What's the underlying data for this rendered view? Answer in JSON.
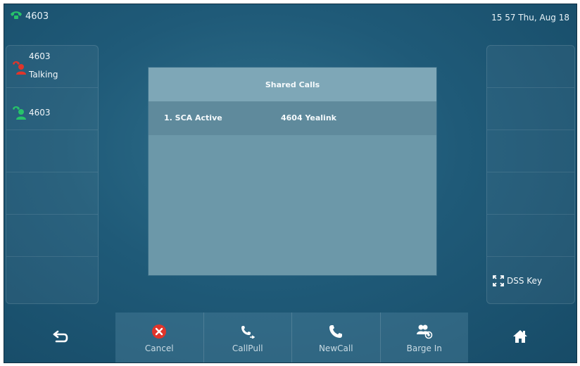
{
  "status_bar": {
    "line_number": "4603",
    "datetime": "15 57 Thu, Aug 18"
  },
  "left_panel": {
    "slots": [
      {
        "number": "4603",
        "status": "Talking",
        "icon": "phone-user-red-icon"
      },
      {
        "number": "4603",
        "icon": "phone-user-green-icon"
      }
    ]
  },
  "right_panel": {
    "dss_key_label": "DSS Key",
    "dss_icon": "expand-arrows-icon"
  },
  "dialog": {
    "title": "Shared Calls",
    "rows": [
      {
        "index_status": "1. SCA Active",
        "party": "4604 Yealink"
      }
    ]
  },
  "softkeys": [
    {
      "label": "Cancel",
      "icon": "cancel-x-icon"
    },
    {
      "label": "CallPull",
      "icon": "callpull-icon"
    },
    {
      "label": "NewCall",
      "icon": "phone-handset-icon"
    },
    {
      "label": "Barge In",
      "icon": "barge-in-icon"
    }
  ],
  "nav": {
    "back_icon": "back-arrow-icon",
    "home_icon": "home-icon"
  },
  "colors": {
    "line_green": "#27c36a",
    "talking_red": "#e0352b",
    "cancel_red": "#e0352b",
    "dialog_title_bg": "#7ea7b7",
    "dialog_body_bg": "#6c98a9"
  }
}
